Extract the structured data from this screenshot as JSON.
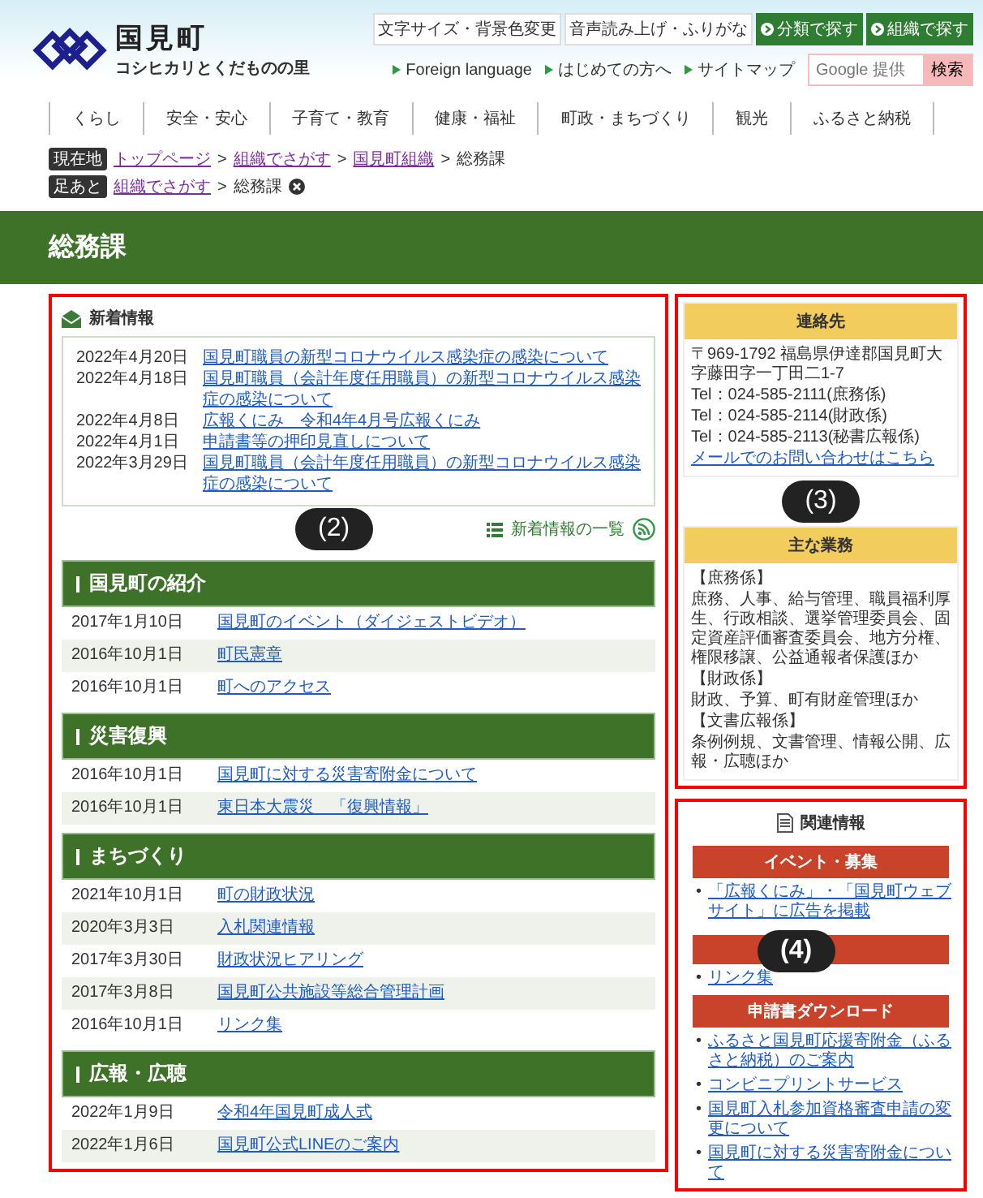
{
  "header": {
    "site_name": "国見町",
    "tagline": "コシヒカリとくだものの里",
    "utility_buttons": [
      {
        "label": "文字サイズ・背景色変更",
        "kind": "plain"
      },
      {
        "label": "音声読み上げ・ふりがな",
        "kind": "plain"
      },
      {
        "label": "分類で探す",
        "kind": "green"
      },
      {
        "label": "組織で探す",
        "kind": "green"
      }
    ],
    "links": [
      "Foreign language",
      "はじめての方へ",
      "サイトマップ"
    ],
    "search": {
      "placeholder": "Google 提供",
      "button": "検索"
    }
  },
  "nav": [
    "くらし",
    "安全・安心",
    "子育て・教育",
    "健康・福祉",
    "町政・まちづくり",
    "観光",
    "ふるさと納税"
  ],
  "breadcrumbs": [
    {
      "badge": "現在地",
      "separator": ">",
      "removable": false,
      "items": [
        {
          "label": "トップページ",
          "kind": "link"
        },
        {
          "label": "組織でさがす",
          "kind": "link"
        },
        {
          "label": "国見町組織",
          "kind": "link"
        },
        {
          "label": "総務課",
          "kind": "current"
        }
      ]
    },
    {
      "badge": "足あと",
      "separator": ">",
      "removable": true,
      "items": [
        {
          "label": "組織でさがす",
          "kind": "link"
        },
        {
          "label": "総務課",
          "kind": "current"
        }
      ]
    }
  ],
  "page_title": "総務課",
  "main": {
    "callout": "(2)",
    "news": {
      "title": "新着情報",
      "items": [
        {
          "date": "2022年4月20日",
          "title": "国見町職員の新型コロナウイルス感染症の感染について"
        },
        {
          "date": "2022年4月18日",
          "title": "国見町職員（会計年度任用職員）の新型コロナウイルス感染症の感染について"
        },
        {
          "date": "2022年4月8日",
          "title": "広報くにみ　令和4年4月号広報くにみ"
        },
        {
          "date": "2022年4月1日",
          "title": "申請書等の押印見直しについて"
        },
        {
          "date": "2022年3月29日",
          "title": "国見町職員（会計年度任用職員）の新型コロナウイルス感染症の感染について"
        }
      ],
      "more_link": "新着情報の一覧"
    },
    "sections": [
      {
        "title": "国見町の紹介",
        "rows": [
          {
            "date": "2017年1月10日",
            "title": "国見町のイベント（ダイジェストビデオ）"
          },
          {
            "date": "2016年10月1日",
            "title": "町民憲章"
          },
          {
            "date": "2016年10月1日",
            "title": "町へのアクセス"
          }
        ]
      },
      {
        "title": "災害復興",
        "rows": [
          {
            "date": "2016年10月1日",
            "title": "国見町に対する災害寄附金について"
          },
          {
            "date": "2016年10月1日",
            "title": "東日本大震災　「復興情報」"
          }
        ]
      },
      {
        "title": "まちづくり",
        "rows": [
          {
            "date": "2021年10月1日",
            "title": "町の財政状況"
          },
          {
            "date": "2020年3月3日",
            "title": "入札関連情報"
          },
          {
            "date": "2017年3月30日",
            "title": "財政状況ヒアリング"
          },
          {
            "date": "2017年3月8日",
            "title": "国見町公共施設等総合管理計画"
          },
          {
            "date": "2016年10月1日",
            "title": "リンク集"
          }
        ]
      },
      {
        "title": "広報・広聴",
        "rows": [
          {
            "date": "2022年1月9日",
            "title": "令和4年国見町成人式"
          },
          {
            "date": "2022年1月6日",
            "title": "国見町公式LINEのご案内"
          }
        ]
      }
    ]
  },
  "contact_box": {
    "callout": "(3)",
    "panels": [
      {
        "title": "連絡先",
        "lines": [
          "〒969-1792 福島県伊達郡国見町大字藤田字一丁田二1-7",
          "Tel：024-585-2111(庶務係)",
          "Tel：024-585-2114(財政係)",
          "Tel：024-585-2113(秘書広報係)"
        ],
        "link": "メールでのお問い合わせはこちら"
      },
      {
        "title": "主な業務",
        "lines": [
          "【庶務係】",
          "庶務、人事、給与管理、職員福利厚生、行政相談、選挙管理委員会、固定資産評価審査委員会、地方分権、権限移譲、公益通報者保護ほか",
          "【財政係】",
          "財政、予算、町有財産管理ほか",
          "【文書広報係】",
          "条例例規、文書管理、情報公開、広報・広聴ほか"
        ]
      }
    ]
  },
  "related_box": {
    "callout": "(4)",
    "title": "関連情報",
    "bullet": "•",
    "groups": [
      {
        "title": "イベント・募集",
        "items": [
          "「広報くにみ」・「国見町ウェブサイト」に広告を掲載"
        ]
      },
      {
        "items": [
          "リンク集"
        ]
      },
      {
        "title": "申請書ダウンロード",
        "items": [
          "ふるさと国見町応援寄附金（ふるさと納税）のご案内",
          "コンビニプリントサービス",
          "国見町入札参加資格審査申請の変更について",
          "国見町に対する災害寄附金について"
        ]
      }
    ]
  }
}
